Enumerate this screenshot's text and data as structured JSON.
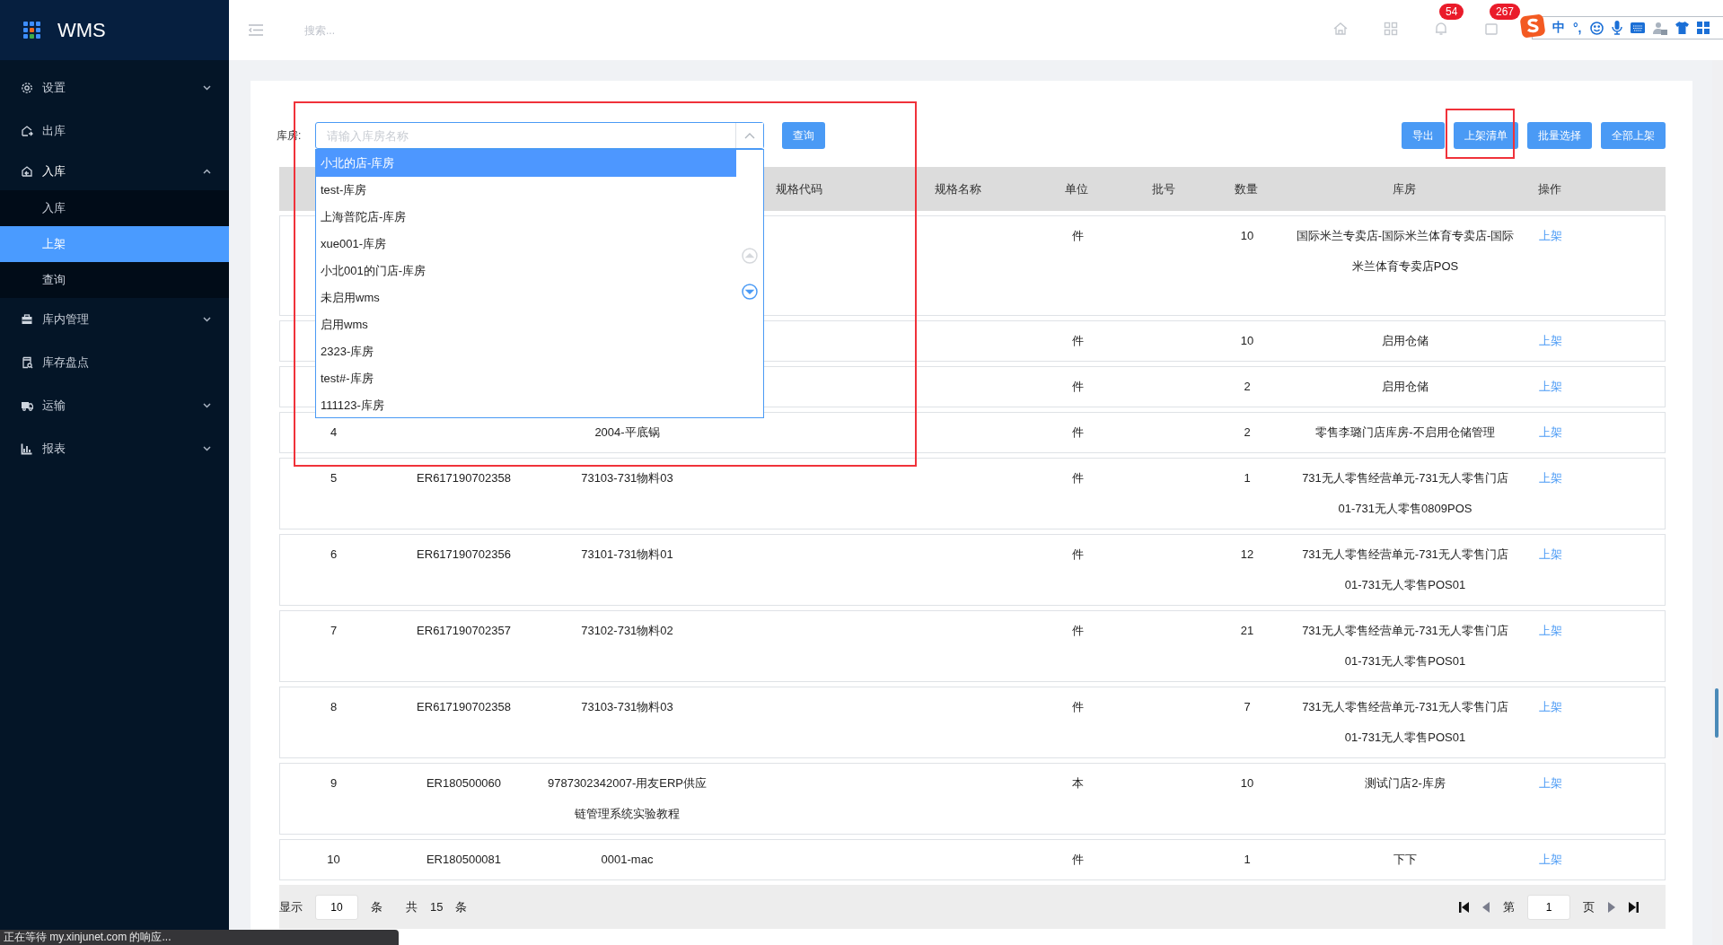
{
  "sidebar": {
    "brand": "WMS",
    "items": [
      {
        "label": "设置",
        "expanded": false
      },
      {
        "label": "出库"
      },
      {
        "label": "入库",
        "expanded": true,
        "children": [
          {
            "label": "入库",
            "selected": false
          },
          {
            "label": "上架",
            "selected": true
          },
          {
            "label": "查询",
            "selected": false
          }
        ]
      },
      {
        "label": "库内管理",
        "expanded": false
      },
      {
        "label": "库存盘点"
      },
      {
        "label": "运输",
        "expanded": false
      },
      {
        "label": "报表",
        "expanded": false
      }
    ]
  },
  "top_bar": {
    "search_placeholder": "搜索...",
    "icons": [
      {
        "kind": "home"
      },
      {
        "kind": "apps"
      },
      {
        "kind": "bell",
        "badge": "54"
      },
      {
        "kind": "mail",
        "badge": "267"
      }
    ]
  },
  "ime_toolbar": {
    "mode": "中",
    "punctuation": "°,"
  },
  "filter": {
    "label": "库房:",
    "placeholder": "请输入库房名称",
    "expanded": true,
    "options": [
      {
        "label": "小北的店-库房",
        "selected": true
      },
      {
        "label": "test-库房",
        "selected": false
      },
      {
        "label": "上海普陀店-库房",
        "selected": false
      },
      {
        "label": "xue001-库房",
        "selected": false
      },
      {
        "label": "小北001的门店-库房",
        "selected": false
      },
      {
        "label": "未启用wms",
        "selected": false
      },
      {
        "label": "启用wms",
        "selected": false
      },
      {
        "label": "2323-库房",
        "selected": false
      },
      {
        "label": "test#-库房",
        "selected": false
      },
      {
        "label": "111123-库房",
        "selected": false
      }
    ]
  },
  "query_button": "查询",
  "actions": [
    "导出",
    "上架清单",
    "批量选择",
    "全部上架"
  ],
  "table": {
    "columns": [
      "规格代码",
      "规格名称",
      "单位",
      "批号",
      "数量",
      "库房",
      "操作"
    ],
    "rows": [
      {
        "unit": "件",
        "qty": "10",
        "warehouse": "国际米兰专卖店-国际米兰体育专卖店-国际米兰体育专卖店POS",
        "action": "上架"
      },
      {
        "unit": "件",
        "qty": "10",
        "warehouse": "启用仓储",
        "action": "上架"
      },
      {
        "unit": "件",
        "qty": "2",
        "warehouse": "启用仓储",
        "action": "上架"
      },
      {
        "index": "4",
        "name": "2004-平底锅",
        "unit": "件",
        "qty": "2",
        "warehouse": "零售李璐门店库房-不启用仓储管理",
        "action": "上架"
      },
      {
        "index": "5",
        "code": "ER617190702358",
        "name": "73103-731物料03",
        "unit": "件",
        "qty": "1",
        "warehouse": "731无人零售经营单元-731无人零售门店01-731无人零售0809POS",
        "action": "上架"
      },
      {
        "index": "6",
        "code": "ER617190702356",
        "name": "73101-731物料01",
        "unit": "件",
        "qty": "12",
        "warehouse": "731无人零售经营单元-731无人零售门店01-731无人零售POS01",
        "action": "上架"
      },
      {
        "index": "7",
        "code": "ER617190702357",
        "name": "73102-731物料02",
        "unit": "件",
        "qty": "21",
        "warehouse": "731无人零售经营单元-731无人零售门店01-731无人零售POS01",
        "action": "上架"
      },
      {
        "index": "8",
        "code": "ER617190702358",
        "name": "73103-731物料03",
        "unit": "件",
        "qty": "7",
        "warehouse": "731无人零售经营单元-731无人零售门店01-731无人零售POS01",
        "action": "上架"
      },
      {
        "index": "9",
        "code": "ER180500060",
        "name": "9787302342007-用友ERP供应链管理系统实验教程",
        "unit": "本",
        "qty": "10",
        "warehouse": "测试门店2-库房",
        "action": "上架"
      },
      {
        "index": "10",
        "code": "ER180500081",
        "name": "0001-mac",
        "unit": "件",
        "qty": "1",
        "warehouse": "下下",
        "action": "上架"
      }
    ]
  },
  "pagination": {
    "show_label": "显示",
    "page_size": "10",
    "size_unit": "条",
    "total_label": "共",
    "total": "15",
    "total_unit": "条",
    "page_label": "第",
    "page": "1",
    "page_unit": "页"
  },
  "status_text": "正在等待 my.xinjunet.com 的响应..."
}
